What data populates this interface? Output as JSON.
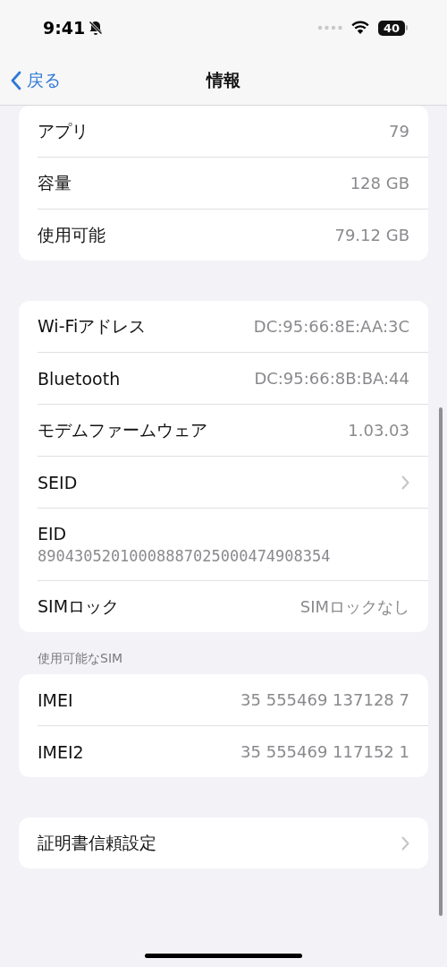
{
  "status_bar": {
    "time": "9:41",
    "battery": "40"
  },
  "nav": {
    "back": "戻る",
    "title": "情報"
  },
  "groups": [
    {
      "rows": [
        {
          "kind": "value",
          "label": "アプリ",
          "value": "79"
        },
        {
          "kind": "value",
          "label": "容量",
          "value": "128 GB"
        },
        {
          "kind": "value",
          "label": "使用可能",
          "value": "79.12 GB"
        }
      ]
    },
    {
      "rows": [
        {
          "kind": "value",
          "label": "Wi-Fiアドレス",
          "value": "DC:95:66:8E:AA:3C"
        },
        {
          "kind": "value",
          "label": "Bluetooth",
          "value": "DC:95:66:8B:BA:44"
        },
        {
          "kind": "value",
          "label": "モデムファームウェア",
          "value": "1.03.03"
        },
        {
          "kind": "link",
          "label": "SEID"
        },
        {
          "kind": "stacked",
          "label": "EID",
          "value": "89043052010008887025000474908354"
        },
        {
          "kind": "value",
          "label": "SIMロック",
          "value": "SIMロックなし"
        }
      ]
    },
    {
      "header": "使用可能なSIM",
      "rows": [
        {
          "kind": "value",
          "label": "IMEI",
          "value": "35 555469 137128 7"
        },
        {
          "kind": "value",
          "label": "IMEI2",
          "value": "35 555469 117152 1"
        }
      ]
    },
    {
      "rows": [
        {
          "kind": "link",
          "label": "証明書信頼設定"
        }
      ]
    }
  ]
}
